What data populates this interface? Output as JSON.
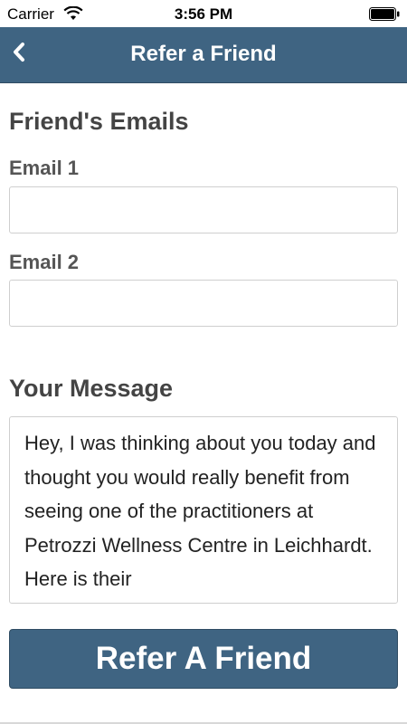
{
  "status_bar": {
    "carrier": "Carrier",
    "time": "3:56 PM",
    "wifi_icon": "wifi-icon",
    "battery_icon": "battery-icon"
  },
  "nav": {
    "title": "Refer a Friend",
    "back_icon": "chevron-left-icon"
  },
  "form": {
    "emails_heading": "Friend's Emails",
    "email1_label": "Email 1",
    "email1_value": "",
    "email2_label": "Email 2",
    "email2_value": "",
    "message_heading": "Your Message",
    "message_value": "Hey, I was thinking about you today and thought you would really benefit from seeing one of the practitioners at Petrozzi Wellness Centre in Leichhardt. Here is their",
    "submit_label": "Refer A Friend"
  },
  "colors": {
    "accent": "#3f6482",
    "background": "#ffffff",
    "heading_text": "#444444"
  }
}
